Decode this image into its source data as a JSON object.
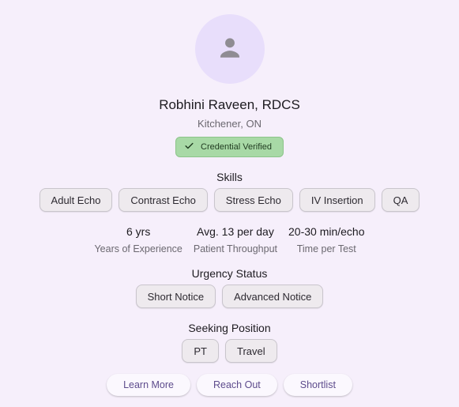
{
  "profile": {
    "name": "Robhini Raveen, RDCS",
    "location": "Kitchener, ON",
    "verified_label": "Credential Verified",
    "avatar_icon": "person-icon"
  },
  "skills": {
    "title": "Skills",
    "items": [
      "Adult Echo",
      "Contrast Echo",
      "Stress Echo",
      "IV Insertion",
      "QA"
    ]
  },
  "stats": [
    {
      "value": "6 yrs",
      "label": "Years of Experience"
    },
    {
      "value": "Avg. 13 per day",
      "label": "Patient Throughput"
    },
    {
      "value": "20-30 min/echo",
      "label": "Time per Test"
    }
  ],
  "urgency": {
    "title": "Urgency Status",
    "items": [
      "Short Notice",
      "Advanced Notice"
    ]
  },
  "seeking": {
    "title": "Seeking Position",
    "items": [
      "PT",
      "Travel"
    ]
  },
  "actions": {
    "learn_more": "Learn More",
    "reach_out": "Reach Out",
    "shortlist": "Shortlist"
  },
  "colors": {
    "background": "#f6effb",
    "avatar_bg": "#e8defb",
    "verified_bg": "#a8d9a6",
    "action_text": "#5d4b8c"
  }
}
